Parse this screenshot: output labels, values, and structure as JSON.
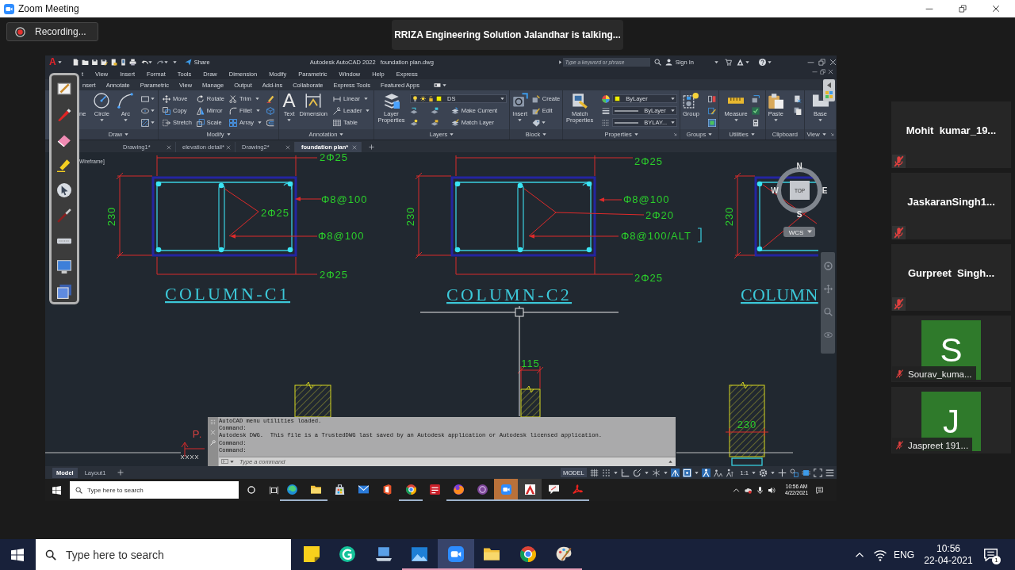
{
  "zoom_window": {
    "title": "Zoom Meeting"
  },
  "recording": {
    "label": "Recording..."
  },
  "speaker_notice": "RRIZA Engineering Solution Jalandhar is talking...",
  "shared_screen": {
    "app_logo": "A",
    "share": "Share",
    "title": "Autodesk AutoCAD 2022",
    "file_name": "foundation plan.dwg",
    "search": {
      "placeholder": "Type a keyword or phrase"
    },
    "sign_in": "Sign In",
    "menu": [
      "t",
      "View",
      "Insert",
      "Format",
      "Tools",
      "Draw",
      "Dimension",
      "Modify",
      "Parametric",
      "Window",
      "Help",
      "Express"
    ],
    "ribbon_tabs": [
      "nsert",
      "Annotate",
      "Parametric",
      "View",
      "Manage",
      "Output",
      "Add-ins",
      "Collaborate",
      "Express Tools",
      "Featured Apps"
    ],
    "ribbon_panels": [
      {
        "title": "Draw",
        "menu": true,
        "large": [
          {
            "label": "ne"
          },
          {
            "label": "Circle"
          },
          {
            "label": "Arc"
          }
        ]
      },
      {
        "title": "Modify",
        "menu": true,
        "small": [
          "Move",
          "Rotate",
          "Trim",
          "Copy",
          "Mirror",
          "Fillet",
          "Stretch",
          "Scale",
          "Array"
        ]
      },
      {
        "title": "Annotation",
        "menu": true,
        "large": [
          {
            "label": "Text",
            "glyph": "A"
          },
          {
            "label": "Dimension"
          }
        ],
        "small": [
          "Linear",
          "Leader",
          "Table"
        ]
      },
      {
        "title": "Layers",
        "menu": true,
        "large": [
          {
            "label": "Layer Properties"
          }
        ],
        "fields": [
          "DS"
        ],
        "small": [
          "Make Current",
          "Match Layer"
        ]
      },
      {
        "title": "Block",
        "menu": true,
        "large": [
          {
            "label": "Insert"
          }
        ],
        "small": [
          "Create",
          "Edit"
        ]
      },
      {
        "title": "Properties",
        "menu": true,
        "large": [
          {
            "label": "Match Properties"
          }
        ],
        "fields": [
          "ByLayer",
          "ByLayer",
          "BYLAY..."
        ]
      },
      {
        "title": "Groups",
        "menu": true,
        "large": [
          {
            "label": "Group"
          }
        ]
      },
      {
        "title": "Utilities",
        "menu": true,
        "large": [
          {
            "label": "Measure"
          }
        ]
      },
      {
        "title": "Clipboard",
        "menu": false,
        "large": [
          {
            "label": "Paste"
          }
        ]
      },
      {
        "title": "View",
        "menu": true,
        "large": [
          {
            "label": "Base"
          }
        ]
      }
    ],
    "file_tabs": [
      {
        "label": "Drawing1*",
        "selected": false
      },
      {
        "label": "elevation detail*",
        "selected": false
      },
      {
        "label": "Drawing2*",
        "selected": false
      },
      {
        "label": "foundation plan*",
        "selected": true
      }
    ],
    "drawing": {
      "view_label": "Wireframe]",
      "sections": [
        {
          "title": "COLUMN-C1",
          "dimension": "230",
          "labels": [
            "2Φ25",
            "Φ8@100",
            "2Φ25",
            "Φ8@100",
            "2Φ25"
          ]
        },
        {
          "title": "COLUMN-C2",
          "dimension": "230",
          "labels": [
            "2Φ25",
            "Φ8@100",
            "2Φ20",
            "Φ8@100/ALT",
            "2Φ25"
          ]
        },
        {
          "title": "COLUMN",
          "dimension": "230"
        }
      ],
      "wall_labels": [
        "115",
        "230",
        "P."
      ],
      "viewcube": {
        "north": "N",
        "west": "W",
        "east": "E",
        "south": "S",
        "face": "TOP",
        "ucs": "WCS"
      }
    },
    "command_line": {
      "history": [
        "AutoCAD menu utilities loaded.",
        "Command:",
        "Autodesk DWG.  This file is a TrustedDWG last saved by an Autodesk application or Autodesk licensed application.",
        "Command:",
        "Command:"
      ],
      "placeholder": "Type a command"
    },
    "layout_tabs": [
      {
        "label": "Model",
        "selected": true
      },
      {
        "label": "Layout1",
        "selected": false
      }
    ],
    "status_bar": {
      "space": "MODEL",
      "toggles": [
        {
          "on": false
        },
        {
          "on": false
        },
        {
          "on": false
        },
        {
          "on": false
        },
        {
          "on": false
        },
        {
          "on": true
        },
        {
          "on": true
        },
        {
          "on": true
        },
        {
          "on": false
        },
        {
          "on": false
        }
      ],
      "scale": "1:1"
    },
    "taskbar": {
      "search": {
        "placeholder": "Type here to search"
      },
      "apps": [
        {
          "running": true,
          "selected": false,
          "flashing": false
        },
        {
          "running": true,
          "selected": false,
          "flashing": false
        },
        {
          "running": false,
          "selected": false,
          "flashing": false
        },
        {
          "running": false,
          "selected": false,
          "flashing": false
        },
        {
          "running": false,
          "selected": false,
          "flashing": false
        },
        {
          "running": true,
          "selected": false,
          "flashing": false
        },
        {
          "running": false,
          "selected": false,
          "flashing": false
        },
        {
          "running": true,
          "selected": false,
          "flashing": false
        },
        {
          "running": true,
          "selected": false,
          "flashing": false
        },
        {
          "running": true,
          "selected": false,
          "flashing": true
        },
        {
          "running": true,
          "selected": true,
          "flashing": false
        },
        {
          "running": true,
          "selected": false,
          "flashing": false
        },
        {
          "running": true,
          "selected": false,
          "flashing": false
        }
      ],
      "time": "10:56 AM",
      "date": "4/22/2021"
    }
  },
  "participants": [
    {
      "name": "Mohit  kumar_19...",
      "kind": "name",
      "muted": true
    },
    {
      "name": "JaskaranSingh1...",
      "kind": "name",
      "muted": true
    },
    {
      "name": "Gurpreet  Singh...",
      "kind": "name",
      "muted": true
    },
    {
      "name": "Sourav_kuma...",
      "kind": "avatar",
      "initial": "S",
      "muted": true
    },
    {
      "name": "Jaspreet 191...",
      "kind": "avatar",
      "initial": "J",
      "muted": true
    }
  ],
  "taskbar": {
    "search": {
      "placeholder": "Type here to search"
    },
    "apps": [
      {
        "running": false,
        "selected": false
      },
      {
        "running": false,
        "selected": false
      },
      {
        "running": false,
        "selected": false
      },
      {
        "running": true,
        "selected": false
      },
      {
        "running": true,
        "selected": true
      },
      {
        "running": true,
        "selected": false
      },
      {
        "running": true,
        "selected": false
      },
      {
        "running": true,
        "selected": false
      }
    ],
    "language": "ENG",
    "time": "10:56",
    "date": "22-04-2021",
    "notifications": "1"
  }
}
